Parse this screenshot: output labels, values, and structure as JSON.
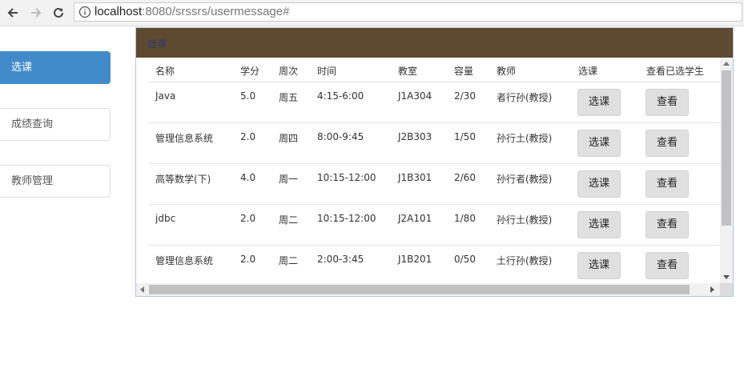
{
  "browser": {
    "url_host": "localhost",
    "url_rest": ":8080/srssrs/usermessage#"
  },
  "sidebar": {
    "items": [
      {
        "label": "选课",
        "active": true
      },
      {
        "label": "成绩查询",
        "active": false
      },
      {
        "label": "教师管理",
        "active": false
      }
    ]
  },
  "panel": {
    "title": "选课",
    "header_color": "#5e4a30"
  },
  "table": {
    "columns": [
      "名称",
      "学分",
      "周次",
      "时间",
      "教室",
      "容量",
      "教师",
      "选课",
      "查看已选学生"
    ],
    "rows": [
      {
        "name": "Java",
        "credit": "5.0",
        "week": "周五",
        "time": "4:15-6:00",
        "room": "J1A304",
        "capacity": "2/30",
        "teacher": "者行孙(教授)",
        "select_label": "选课",
        "view_label": "查看"
      },
      {
        "name": "管理信息系统",
        "credit": "2.0",
        "week": "周四",
        "time": "8:00-9:45",
        "room": "J2B303",
        "capacity": "1/50",
        "teacher": "孙行土(教授)",
        "select_label": "选课",
        "view_label": "查看"
      },
      {
        "name": "高等数学(下)",
        "credit": "4.0",
        "week": "周一",
        "time": "10:15-12:00",
        "room": "J1B301",
        "capacity": "2/60",
        "teacher": "孙行者(教授)",
        "select_label": "选课",
        "view_label": "查看"
      },
      {
        "name": "jdbc",
        "credit": "2.0",
        "week": "周二",
        "time": "10:15-12:00",
        "room": "J2A101",
        "capacity": "1/80",
        "teacher": "孙行土(教授)",
        "select_label": "选课",
        "view_label": "查看"
      },
      {
        "name": "管理信息系统",
        "credit": "2.0",
        "week": "周二",
        "time": "2:00-3:45",
        "room": "J1B201",
        "capacity": "0/50",
        "teacher": "土行孙(教授)",
        "select_label": "选课",
        "view_label": "查看"
      }
    ]
  }
}
